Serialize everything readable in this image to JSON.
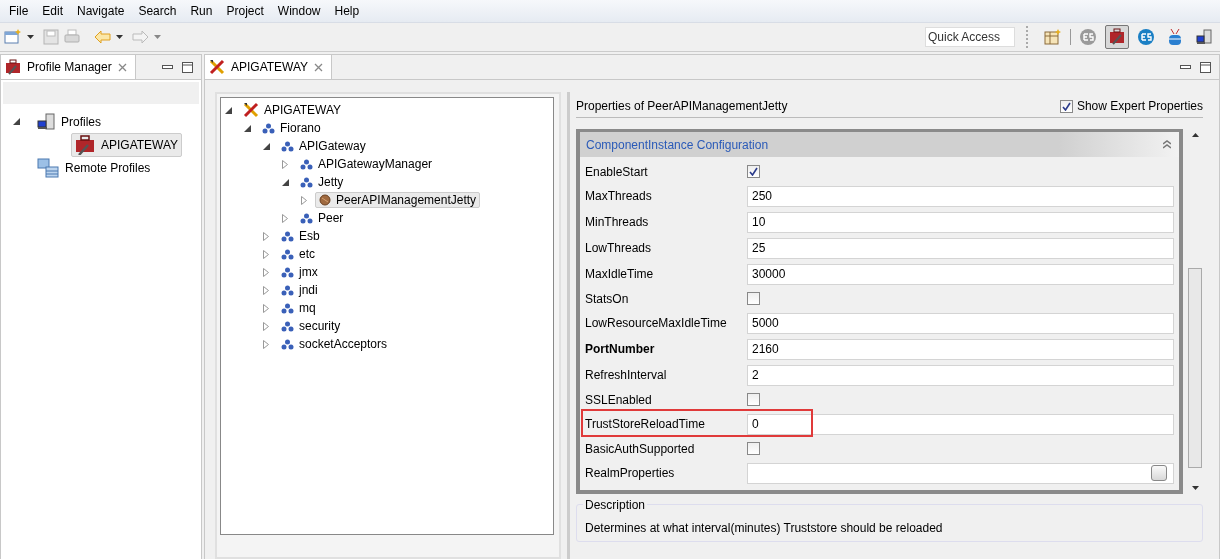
{
  "menu": [
    "File",
    "Edit",
    "Navigate",
    "Search",
    "Run",
    "Project",
    "Window",
    "Help"
  ],
  "toolbar": {
    "quick_access": {
      "placeholder": "Quick Access"
    },
    "perspectives": [
      {
        "kind": "open",
        "selected": false
      },
      {
        "kind": "es-grey",
        "selected": false
      },
      {
        "kind": "profile",
        "selected": true
      },
      {
        "kind": "es-blue",
        "selected": false
      },
      {
        "kind": "database",
        "selected": false
      },
      {
        "kind": "computer",
        "selected": false
      }
    ]
  },
  "profile_view": {
    "tab": "Profile Manager",
    "tree": [
      {
        "label": "Profiles",
        "kind": "computer",
        "expanded": true,
        "selected": false,
        "children": [
          {
            "label": "APIGATEWAY",
            "kind": "profile",
            "selected": true
          }
        ]
      },
      {
        "label": "Remote Profiles",
        "kind": "remote",
        "selected": false
      }
    ]
  },
  "editor": {
    "tab": "APIGATEWAY",
    "tree": [
      {
        "label": "APIGATEWAY",
        "kind": "gateway",
        "expanded": true,
        "selected": false,
        "children": [
          {
            "label": "Fiorano",
            "kind": "package",
            "expanded": true,
            "selected": false,
            "children": [
              {
                "label": "APIGateway",
                "kind": "package",
                "expanded": true,
                "selected": false,
                "children": [
                  {
                    "label": "APIGatewayManager",
                    "kind": "package",
                    "expanded": false,
                    "selected": false
                  },
                  {
                    "label": "Jetty",
                    "kind": "package",
                    "expanded": true,
                    "selected": false,
                    "children": [
                      {
                        "label": "PeerAPIManagementJetty",
                        "kind": "bean",
                        "expanded": false,
                        "selected": true
                      }
                    ]
                  },
                  {
                    "label": "Peer",
                    "kind": "package",
                    "expanded": false,
                    "selected": false
                  }
                ]
              },
              {
                "label": "Esb",
                "kind": "package",
                "expanded": false,
                "selected": false
              },
              {
                "label": "etc",
                "kind": "package",
                "expanded": false,
                "selected": false
              },
              {
                "label": "jmx",
                "kind": "package",
                "expanded": false,
                "selected": false
              },
              {
                "label": "jndi",
                "kind": "package",
                "expanded": false,
                "selected": false
              },
              {
                "label": "mq",
                "kind": "package",
                "expanded": false,
                "selected": false
              },
              {
                "label": "security",
                "kind": "package",
                "expanded": false,
                "selected": false
              },
              {
                "label": "socketAcceptors",
                "kind": "package",
                "expanded": false,
                "selected": false
              }
            ]
          }
        ]
      }
    ]
  },
  "properties": {
    "title": "Properties of PeerAPIManagementJetty",
    "expert": {
      "label": "Show Expert Properties",
      "checked": true
    },
    "section": "ComponentInstance Configuration",
    "rows": [
      {
        "name": "EnableStart",
        "kind": "checkbox",
        "checked": true,
        "bold": false,
        "highlighted": false
      },
      {
        "name": "MaxThreads",
        "kind": "text",
        "value": "250",
        "bold": false,
        "highlighted": false
      },
      {
        "name": "MinThreads",
        "kind": "text",
        "value": "10",
        "bold": false,
        "highlighted": false
      },
      {
        "name": "LowThreads",
        "kind": "text",
        "value": "25",
        "bold": false,
        "highlighted": false
      },
      {
        "name": "MaxIdleTime",
        "kind": "text",
        "value": "30000",
        "bold": false,
        "highlighted": false
      },
      {
        "name": "StatsOn",
        "kind": "checkbox",
        "checked": false,
        "bold": false,
        "highlighted": false
      },
      {
        "name": "LowResourceMaxIdleTime",
        "kind": "text",
        "value": "5000",
        "bold": false,
        "highlighted": false
      },
      {
        "name": "PortNumber",
        "kind": "text",
        "value": "2160",
        "bold": true,
        "highlighted": false
      },
      {
        "name": "RefreshInterval",
        "kind": "text",
        "value": "2",
        "bold": false,
        "highlighted": false
      },
      {
        "name": "SSLEnabled",
        "kind": "checkbox",
        "checked": false,
        "bold": false,
        "highlighted": false
      },
      {
        "name": "TrustStoreReloadTime",
        "kind": "text",
        "value": "0",
        "bold": false,
        "highlighted": true
      },
      {
        "name": "BasicAuthSupported",
        "kind": "checkbox",
        "checked": false,
        "bold": false,
        "highlighted": false
      },
      {
        "name": "RealmProperties",
        "kind": "dialog",
        "bold": false,
        "highlighted": false
      }
    ],
    "description": {
      "title": "Description",
      "text": "Determines at what interval(minutes) Truststore should be reloaded"
    }
  }
}
